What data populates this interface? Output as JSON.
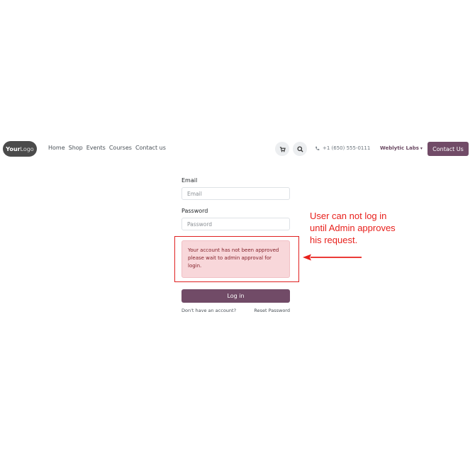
{
  "navbar": {
    "logo": {
      "part1": "Your",
      "part2": "Logo"
    },
    "links": [
      "Home",
      "Shop",
      "Events",
      "Courses",
      "Contact us"
    ],
    "cart_icon": "cart-icon",
    "search_icon": "search-icon",
    "phone_icon": "phone-icon",
    "phone": "+1 (650) 555-0111",
    "company": "Weblytic Labs",
    "contact_button": "Contact Us"
  },
  "login_form": {
    "email_label": "Email",
    "email_placeholder": "Email",
    "password_label": "Password",
    "password_placeholder": "Password",
    "alert_text": "Your account has not been approved please wait to admin approval for login.",
    "login_button": "Log in",
    "signup_link": "Don't have an account?",
    "reset_link": "Reset Password"
  },
  "annotation": {
    "lines": [
      "User can not log in",
      "until Admin approves",
      "his request."
    ]
  },
  "colors": {
    "brand": "#714b67",
    "alert_bg": "#f8d7da",
    "alert_text": "#842029",
    "annotation_red": "#e8201c"
  }
}
